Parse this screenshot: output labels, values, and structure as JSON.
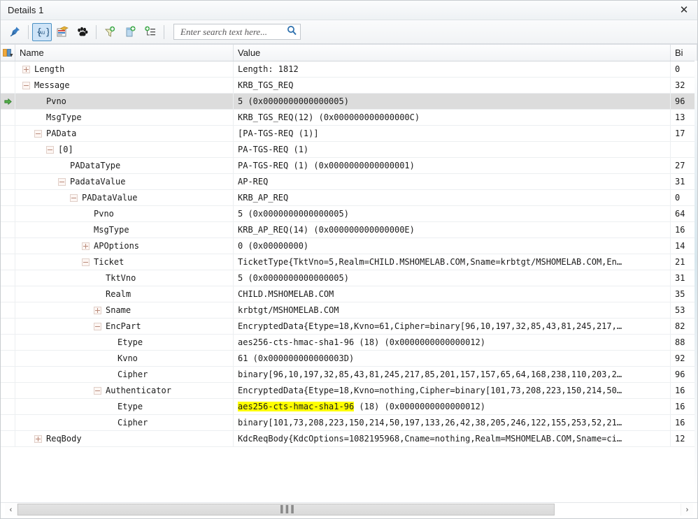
{
  "window": {
    "title": "Details 1",
    "close_label": "✕"
  },
  "toolbar": {
    "buttons": [
      {
        "name": "pin-icon",
        "title": "Pin",
        "active": false
      },
      {
        "name": "braces-au-icon",
        "title": "{AU}",
        "active": true
      },
      {
        "name": "card-stack-icon",
        "title": "Columns",
        "active": false
      },
      {
        "name": "paw-print-icon",
        "title": "Trace",
        "active": false
      },
      {
        "name": "filter-add-icon",
        "title": "Add Filter",
        "active": false
      },
      {
        "name": "column-add-icon",
        "title": "Add Column",
        "active": false
      },
      {
        "name": "group-add-icon",
        "title": "Add Grouping",
        "active": false
      }
    ],
    "search": {
      "placeholder": "Enter search text here...",
      "value": "",
      "icon": "search-icon"
    }
  },
  "grid": {
    "columns": [
      {
        "key": "gutter",
        "label": ""
      },
      {
        "key": "name",
        "label": "Name"
      },
      {
        "key": "value",
        "label": "Value"
      },
      {
        "key": "bit",
        "label": "Bi"
      }
    ],
    "highlight_color": "#ffff00",
    "current_row_color": "#dcdcdc",
    "rows": [
      {
        "depth": 0,
        "toggle": "plus",
        "name": "Length",
        "value": "Length: 1812",
        "bit": "0",
        "current": false,
        "highlight": ""
      },
      {
        "depth": 0,
        "toggle": "minus",
        "name": "Message",
        "value": "KRB_TGS_REQ",
        "bit": "32",
        "current": false,
        "highlight": ""
      },
      {
        "depth": 1,
        "toggle": "none",
        "name": "Pvno",
        "value": "5 (0x0000000000000005)",
        "bit": "96",
        "current": true,
        "highlight": ""
      },
      {
        "depth": 1,
        "toggle": "none",
        "name": "MsgType",
        "value": "KRB_TGS_REQ(12) (0x000000000000000C)",
        "bit": "13",
        "current": false,
        "highlight": ""
      },
      {
        "depth": 1,
        "toggle": "minus",
        "name": "PAData",
        "value": "[PA-TGS-REQ (1)]",
        "bit": "17",
        "current": false,
        "highlight": ""
      },
      {
        "depth": 2,
        "toggle": "minus",
        "name": "[0]",
        "value": "PA-TGS-REQ (1)",
        "bit": "",
        "current": false,
        "highlight": ""
      },
      {
        "depth": 3,
        "toggle": "none",
        "name": "PADataType",
        "value": "PA-TGS-REQ (1) (0x0000000000000001)",
        "bit": "27",
        "current": false,
        "highlight": ""
      },
      {
        "depth": 3,
        "toggle": "minus",
        "name": "PadataValue",
        "value": "AP-REQ",
        "bit": "31",
        "current": false,
        "highlight": ""
      },
      {
        "depth": 4,
        "toggle": "minus",
        "name": "PADataValue",
        "value": "KRB_AP_REQ",
        "bit": "0",
        "current": false,
        "highlight": ""
      },
      {
        "depth": 5,
        "toggle": "none",
        "name": "Pvno",
        "value": "5 (0x0000000000000005)",
        "bit": "64",
        "current": false,
        "highlight": ""
      },
      {
        "depth": 5,
        "toggle": "none",
        "name": "MsgType",
        "value": "KRB_AP_REQ(14) (0x000000000000000E)",
        "bit": "16",
        "current": false,
        "highlight": ""
      },
      {
        "depth": 5,
        "toggle": "plus",
        "name": "APOptions",
        "value": "0 (0x00000000)",
        "bit": "14",
        "current": false,
        "highlight": ""
      },
      {
        "depth": 5,
        "toggle": "minus",
        "name": "Ticket",
        "value": "TicketType{TktVno=5,Realm=CHILD.MSHOMELAB.COM,Sname=krbtgt/MSHOMELAB.COM,En…",
        "bit": "21",
        "current": false,
        "highlight": ""
      },
      {
        "depth": 6,
        "toggle": "none",
        "name": "TktVno",
        "value": "5 (0x0000000000000005)",
        "bit": "31",
        "current": false,
        "highlight": ""
      },
      {
        "depth": 6,
        "toggle": "none",
        "name": "Realm",
        "value": "CHILD.MSHOMELAB.COM",
        "bit": "35",
        "current": false,
        "highlight": ""
      },
      {
        "depth": 6,
        "toggle": "plus",
        "name": "Sname",
        "value": "krbtgt/MSHOMELAB.COM",
        "bit": "53",
        "current": false,
        "highlight": ""
      },
      {
        "depth": 6,
        "toggle": "minus",
        "name": "EncPart",
        "value": "EncryptedData{Etype=18,Kvno=61,Cipher=binary[96,10,197,32,85,43,81,245,217,…",
        "bit": "82",
        "current": false,
        "highlight": ""
      },
      {
        "depth": 7,
        "toggle": "none",
        "name": "Etype",
        "value": "aes256-cts-hmac-sha1-96 (18) (0x0000000000000012)",
        "bit": "88",
        "current": false,
        "highlight": ""
      },
      {
        "depth": 7,
        "toggle": "none",
        "name": "Kvno",
        "value": "61 (0x000000000000003D)",
        "bit": "92",
        "current": false,
        "highlight": ""
      },
      {
        "depth": 7,
        "toggle": "none",
        "name": "Cipher",
        "value": "binary[96,10,197,32,85,43,81,245,217,85,201,157,157,65,64,168,238,110,203,2…",
        "bit": "96",
        "current": false,
        "highlight": ""
      },
      {
        "depth": 6,
        "toggle": "minus",
        "name": "Authenticator",
        "value": "EncryptedData{Etype=18,Kvno=nothing,Cipher=binary[101,73,208,223,150,214,50…",
        "bit": "16",
        "current": false,
        "highlight": ""
      },
      {
        "depth": 7,
        "toggle": "none",
        "name": "Etype",
        "value": "aes256-cts-hmac-sha1-96 (18) (0x0000000000000012)",
        "bit": "16",
        "current": false,
        "highlight": "aes256-cts-hmac-sha1-96"
      },
      {
        "depth": 7,
        "toggle": "none",
        "name": "Cipher",
        "value": "binary[101,73,208,223,150,214,50,197,133,26,42,38,205,246,122,155,253,52,21…",
        "bit": "16",
        "current": false,
        "highlight": ""
      },
      {
        "depth": 1,
        "toggle": "plus",
        "name": "ReqBody",
        "value": "KdcReqBody{KdcOptions=1082195968,Cname=nothing,Realm=MSHOMELAB.COM,Sname=ci…",
        "bit": "12",
        "current": false,
        "highlight": ""
      }
    ]
  },
  "scrollbar": {
    "left_label": "‹",
    "right_label": "›",
    "grip": "▐▐▐"
  }
}
